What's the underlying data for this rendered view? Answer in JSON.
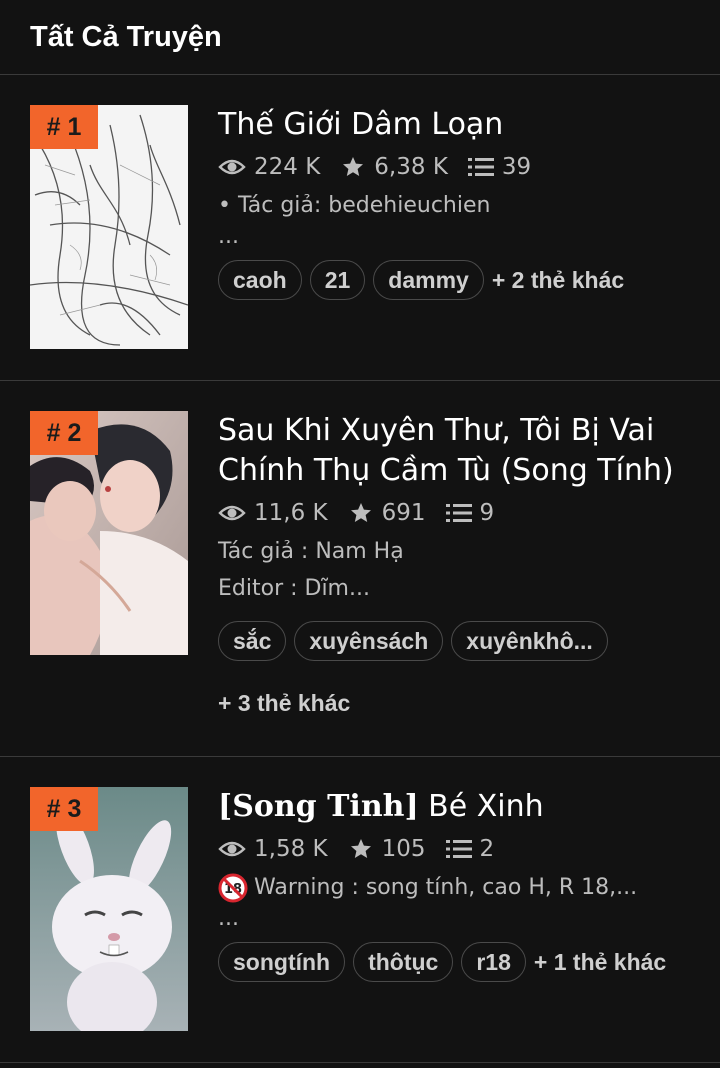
{
  "header": {
    "title": "Tất Cả Truyện"
  },
  "stories": [
    {
      "rank": "# 1",
      "title": "Thế Giới Dâm Loạn",
      "views": "224 K",
      "stars": "6,38 K",
      "chapters": "39",
      "desc_line1": "• Tác giả: bedehieuchien",
      "desc_line2": "...",
      "tags": [
        "caoh",
        "21",
        "dammy"
      ],
      "more_tags": "+ 2 thẻ khác"
    },
    {
      "rank": "# 2",
      "title": "Sau Khi Xuyên Thư, Tôi Bị Vai Chính Thụ Cầm Tù (Song Tính)",
      "views": "11,6 K",
      "stars": "691",
      "chapters": "9",
      "desc_line1": "Tác giả : Nam Hạ",
      "desc_line2": "Editor : Dĩm...",
      "tags": [
        "sắc",
        "xuyênsách",
        "xuyênkhô..."
      ],
      "more_tags": "+ 3 thẻ khác"
    },
    {
      "rank": "# 3",
      "title_bracket": "[Song Tinh]",
      "title_rest": " Bé Xinh",
      "views": "1,58 K",
      "stars": "105",
      "chapters": "2",
      "desc_line1": "Warning : song tính, cao H, R 18,...",
      "desc_line2": "...",
      "tags": [
        "songtính",
        "thôtục",
        "r18"
      ],
      "more_tags": "+ 1 thẻ khác"
    }
  ],
  "icons": {
    "views": "eye-icon",
    "stars": "star-icon",
    "chapters": "list-icon",
    "warning": "no-under-18-icon"
  },
  "colors": {
    "background": "#121212",
    "rank_badge": "#f2652b",
    "divider": "#3a3a3a"
  }
}
